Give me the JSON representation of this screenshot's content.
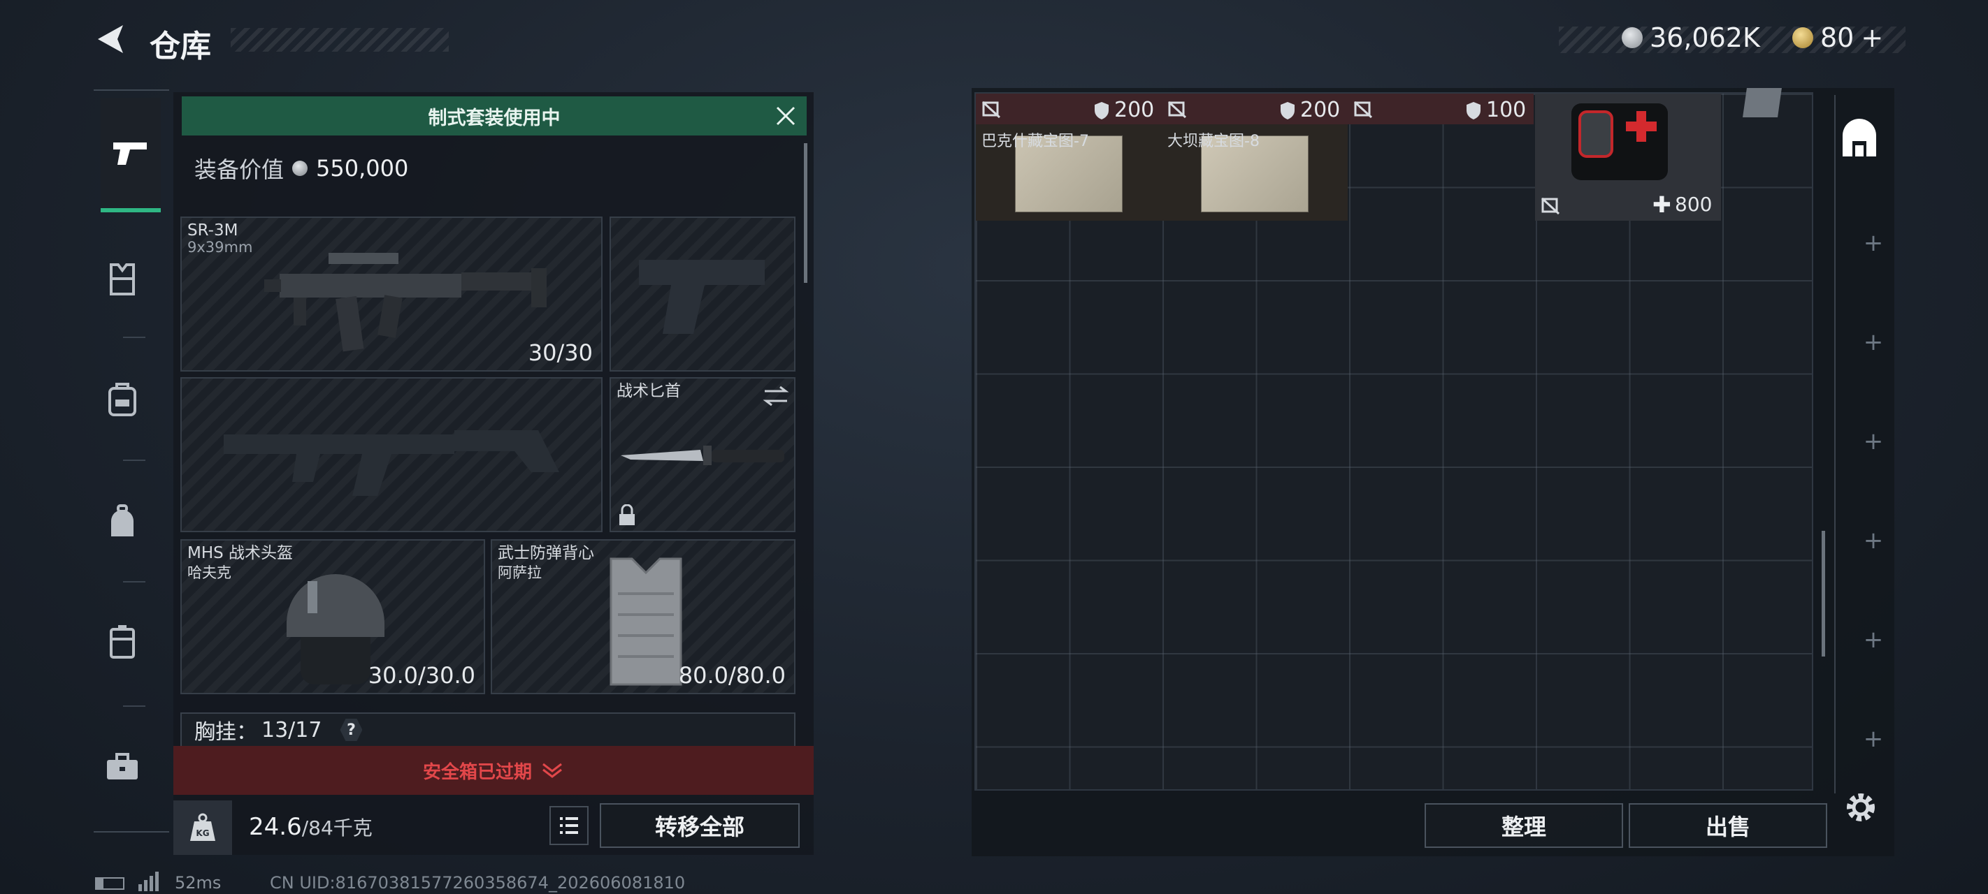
{
  "header": {
    "title": "仓库",
    "currency_primary": "36,062K",
    "currency_secondary": "80",
    "currency_secondary_plus": "+"
  },
  "loadout": {
    "banner": "制式套装使用中",
    "value_label": "装备价值",
    "value": "550,000",
    "primary_weapon": {
      "name": "SR-3M",
      "caliber": "9x39mm",
      "ammo": "30/30"
    },
    "melee": {
      "name": "战术匕首"
    },
    "helmet": {
      "name": "MHS 战术头盔",
      "sub": "哈夫克",
      "durability": "30.0/30.0"
    },
    "armor": {
      "name": "武士防弹背心",
      "sub": "阿萨拉",
      "durability": "80.0/80.0"
    },
    "chest_rig": {
      "label": "胸挂：",
      "value": "13/17",
      "help": "?"
    },
    "safe_box_status": "安全箱已过期",
    "weight": "24.6",
    "weight_total": "/84千克",
    "weight_icon_text": "KG",
    "transfer_all": "转移全部"
  },
  "stash": {
    "items": [
      {
        "value": "200",
        "name": "巴克什藏宝图-7"
      },
      {
        "value": "200",
        "name": "大坝藏宝图-8"
      },
      {
        "value": "100",
        "name": ""
      },
      {
        "value": "800",
        "name": ""
      }
    ],
    "sort_button": "整理",
    "sell_button": "出售"
  },
  "footer": {
    "ping": "52ms",
    "uid": "CN UID:8167038157726035867​4_202606081810"
  },
  "colors": {
    "accent_green": "#1d5a44",
    "alert_red": "#5a1f22",
    "alert_text": "#e1484a"
  }
}
